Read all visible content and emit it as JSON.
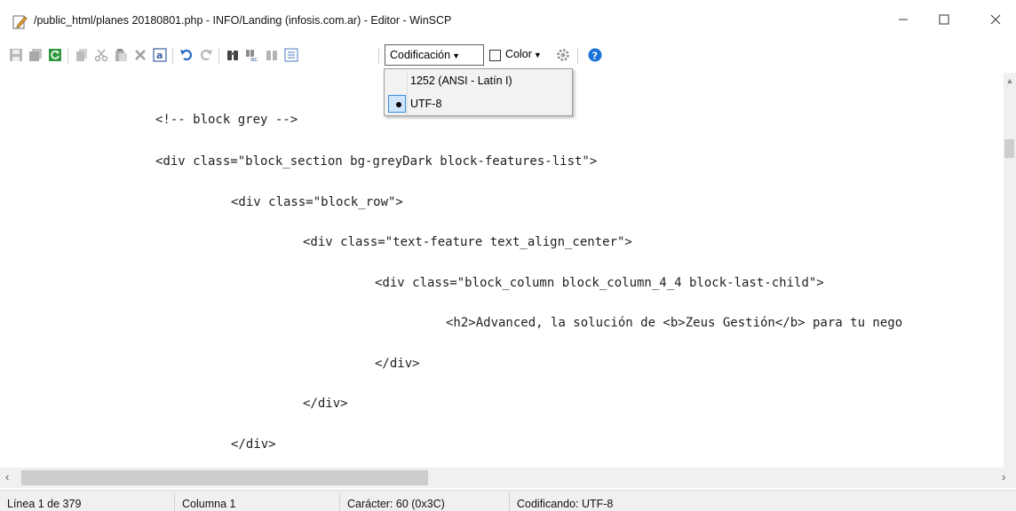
{
  "window": {
    "title": "/public_html/planes 20180801.php - INFO/Landing (infosis.com.ar) - Editor - WinSCP",
    "minimize_icon": "minimize-icon",
    "maximize_icon": "maximize-icon",
    "close_icon": "close-icon"
  },
  "toolbar": {
    "encoding_label": "Codificación",
    "color_label": "Color"
  },
  "encoding_menu": {
    "items": [
      {
        "label": "1252  (ANSI - Latín I)",
        "selected": false
      },
      {
        "label": "UTF-8",
        "selected": true
      }
    ]
  },
  "editor": {
    "lines": [
      "<!-- block grey -->",
      "<div class=\"block_section bg-greyDark block-features-list\">",
      "<div class=\"block_row\">",
      "<div class=\"text-feature text_align_center\">",
      "<div class=\"block_column block_column_4_4 block-last-child\">",
      "<h2>Advanced, la solución de <b>Zeus Gestión</b> para tu nego",
      "</div>",
      "</div>",
      "</div>"
    ]
  },
  "status": {
    "line": "Línea 1 de 379",
    "column": "Columna 1",
    "character": "Carácter: 60 (0x3C)",
    "encoding": "Codificando: UTF-8"
  },
  "colors": {
    "menu_highlight": "#cfe5fb",
    "menu_highlight_border": "#3b8edc",
    "help_blue": "#1a73d9",
    "toolbar_icon_gray": "#9a9a9a"
  }
}
